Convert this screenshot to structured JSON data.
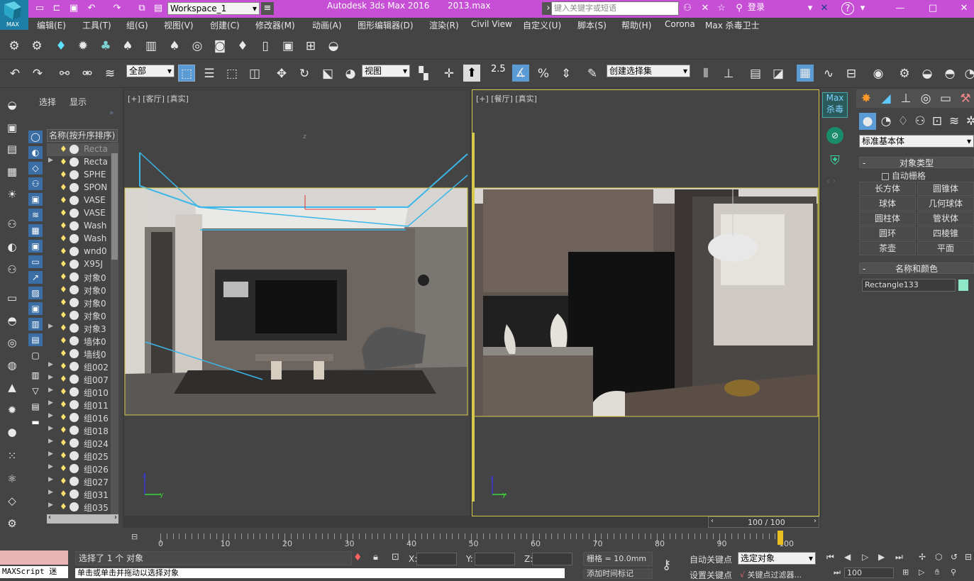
{
  "window": {
    "title": "Autodesk 3ds Max 2016",
    "file": "2013.max",
    "workspace": "Workspace_1",
    "search_placeholder": "键入关键字或短语",
    "login": "登录",
    "app_logo": "MAX"
  },
  "menu": [
    "编辑(E)",
    "工具(T)",
    "组(G)",
    "视图(V)",
    "创建(C)",
    "修改器(M)",
    "动画(A)",
    "图形编辑器(D)",
    "渲染(R)",
    "Civil View",
    "自定义(U)",
    "脚本(S)",
    "帮助(H)",
    "Corona",
    "Max 杀毒卫士"
  ],
  "toolbar": {
    "filter_value": "全部",
    "refcoord_value": "视图",
    "snap_angle": "2.5",
    "named_selection": "创建选择集"
  },
  "scene_explorer": {
    "tab_select": "选择",
    "tab_display": "显示",
    "column_header": "名称(按升序排序)",
    "items": [
      "Recta",
      "Recta",
      "SPHE",
      "SPON",
      "VASE",
      "VASE",
      "Wash",
      "Wash",
      "wnd0",
      "X95J",
      "对象0",
      "对象0",
      "对象0",
      "对象0",
      "对象3",
      "墙体0",
      "墙线0",
      "组002",
      "组007",
      "组010",
      "组011",
      "组016",
      "组018",
      "组024",
      "组025",
      "组026",
      "组027",
      "组031",
      "组035"
    ]
  },
  "viewports": {
    "left_label": "[+] [客厅] [真实]",
    "right_label": "[+] [餐厅] [真实]"
  },
  "right_panel": {
    "logo_top": "Max",
    "logo_bottom": "杀毒",
    "category": "标准基本体",
    "object_type_title": "对象类型",
    "autogrid": "自动栅格",
    "buttons": [
      "长方体",
      "圆锥体",
      "球体",
      "几何球体",
      "圆柱体",
      "管状体",
      "圆环",
      "四棱锥",
      "茶壶",
      "平面"
    ],
    "name_color_title": "名称和颜色",
    "object_name": "Rectangle133",
    "object_color": "#8ee8c8"
  },
  "timeline": {
    "frame_display": "100 / 100",
    "ticks": [
      "0",
      "10",
      "20",
      "30",
      "40",
      "50",
      "60",
      "70",
      "80",
      "90",
      "100"
    ],
    "current_frame": 100
  },
  "status": {
    "maxscript_label": "MAXScript 迷",
    "selection_info": "选择了 1 个 对象",
    "prompt": "单击或单击并拖动以选择对象",
    "x_label": "X:",
    "y_label": "Y:",
    "z_label": "Z:",
    "grid": "栅格 = 10.0mm",
    "add_time_tag": "添加时间标记",
    "auto_key": "自动关键点",
    "set_key": "设置关键点",
    "key_mode_value": "选定对象",
    "key_filters": "关键点过滤器...",
    "frame_field": "100"
  },
  "colors": {
    "titlebar": "#c64fd6",
    "viewport_border_active": "#d6c84a",
    "selection_cyan": "#3ab6e8"
  }
}
